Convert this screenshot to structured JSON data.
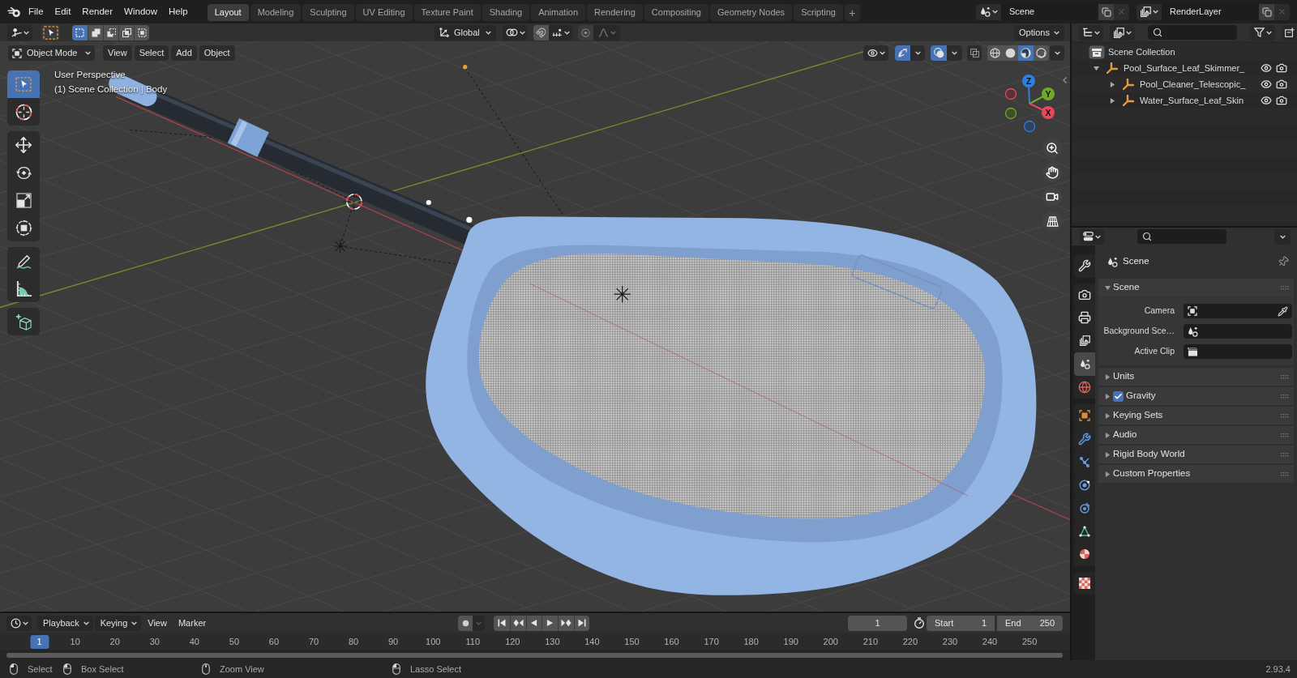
{
  "topbar": {
    "menus": [
      "File",
      "Edit",
      "Render",
      "Window",
      "Help"
    ],
    "workspaces": [
      {
        "label": "Layout",
        "selected": true
      },
      {
        "label": "Modeling",
        "selected": false
      },
      {
        "label": "Sculpting",
        "selected": false
      },
      {
        "label": "UV Editing",
        "selected": false
      },
      {
        "label": "Texture Paint",
        "selected": false
      },
      {
        "label": "Shading",
        "selected": false
      },
      {
        "label": "Animation",
        "selected": false
      },
      {
        "label": "Rendering",
        "selected": false
      },
      {
        "label": "Compositing",
        "selected": false
      },
      {
        "label": "Geometry Nodes",
        "selected": false
      },
      {
        "label": "Scripting",
        "selected": false
      }
    ],
    "add_workspace": "+",
    "scene": "Scene",
    "view_layer": "RenderLayer"
  },
  "tool_header": {
    "select_modes": [
      {
        "selected": true
      },
      {
        "selected": false
      },
      {
        "selected": false
      },
      {
        "selected": false
      },
      {
        "selected": false
      }
    ],
    "orientation": "Global",
    "options": "Options"
  },
  "viewport": {
    "mode": "Object Mode",
    "menus": [
      "View",
      "Select",
      "Add",
      "Object"
    ],
    "gizmos_on": true,
    "overlays_on": true,
    "xray_on": false,
    "shading_modes": [
      {
        "selected": false
      },
      {
        "selected": false
      },
      {
        "selected": true
      },
      {
        "selected": false
      }
    ],
    "view_name": "User Perspective",
    "object_info": "(1) Scene Collection | Body",
    "tool_groups": [
      [
        {
          "selected": true
        },
        {
          "selected": false
        }
      ],
      [
        {
          "selected": false
        },
        {
          "selected": false
        },
        {
          "selected": false
        },
        {
          "selected": false
        }
      ],
      [
        {
          "selected": false
        },
        {
          "selected": false
        }
      ],
      [
        {
          "selected": false
        }
      ]
    ],
    "axes": [
      "Z",
      "Y",
      "X"
    ]
  },
  "outliner": {
    "root": "Scene Collection",
    "items": [
      {
        "name": "Pool_Surface_Leaf_Skimmer_",
        "expanded": true,
        "children": [
          {
            "name": "Pool_Cleaner_Telescopic_",
            "expanded": false
          },
          {
            "name": "Water_Surface_Leaf_Skin",
            "expanded": false
          }
        ]
      }
    ]
  },
  "properties": {
    "tab_groups": [
      [
        {
          "selected": false
        }
      ],
      [
        {
          "selected": false
        },
        {
          "selected": false
        },
        {
          "selected": false
        },
        {
          "selected": true
        },
        {
          "selected": false
        }
      ],
      [
        {
          "selected": false
        },
        {
          "selected": false
        },
        {
          "selected": false
        },
        {
          "selected": false
        },
        {
          "selected": false
        },
        {
          "selected": false
        },
        {
          "selected": false
        }
      ],
      [
        {
          "selected": false
        }
      ]
    ],
    "context": "Scene",
    "panels": [
      {
        "title": "Scene",
        "kind": "plain",
        "expanded": true,
        "fields": [
          {
            "label": "Camera"
          },
          {
            "label": "Background Sce…"
          },
          {
            "label": "Active Clip"
          }
        ]
      },
      {
        "title": "Units",
        "kind": "plain",
        "expanded": false
      },
      {
        "title": "Gravity",
        "kind": "checkbox",
        "checked": true,
        "expanded": false
      },
      {
        "title": "Keying Sets",
        "kind": "plain",
        "expanded": false
      },
      {
        "title": "Audio",
        "kind": "plain",
        "expanded": false
      },
      {
        "title": "Rigid Body World",
        "kind": "plain",
        "expanded": false
      },
      {
        "title": "Custom Properties",
        "kind": "plain",
        "expanded": false
      }
    ]
  },
  "timeline": {
    "menus": [
      {
        "label": "Playback",
        "kind": "dropdown"
      },
      {
        "label": "Keying",
        "kind": "dropdown"
      },
      {
        "label": "View",
        "kind": "menu"
      },
      {
        "label": "Marker",
        "kind": "menu"
      }
    ],
    "current_frame": "1",
    "start_label": "Start",
    "start": "1",
    "end_label": "End",
    "end": "250",
    "playhead": "1",
    "ticks": [
      "10",
      "20",
      "30",
      "40",
      "50",
      "60",
      "70",
      "80",
      "90",
      "100",
      "110",
      "120",
      "130",
      "140",
      "150",
      "160",
      "170",
      "180",
      "190",
      "200",
      "210",
      "220",
      "230",
      "240",
      "250"
    ]
  },
  "status_bar": {
    "hints": [
      "Select",
      "Box Select",
      "Zoom View",
      "Lasso Select"
    ],
    "version": "2.93.4"
  }
}
